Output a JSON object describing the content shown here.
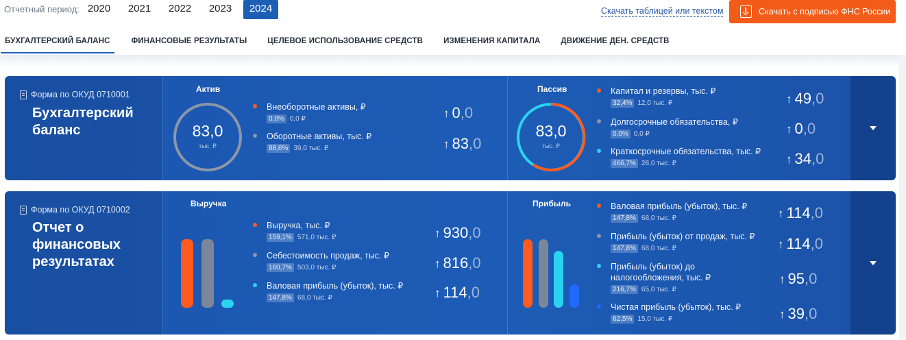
{
  "period": {
    "label": "Отчетный период:",
    "years": [
      "2020",
      "2021",
      "2022",
      "2023",
      "2024"
    ],
    "active_year": "2024"
  },
  "download": {
    "link_label": "Скачать таблицей или текстом",
    "button_label": "Скачать с подписью ФНС России"
  },
  "tabs": [
    "БУХГАЛТЕРСКИЙ БАЛАНС",
    "ФИНАНСОВЫЕ РЕЗУЛЬТАТЫ",
    "ЦЕЛЕВОЕ ИСПОЛЬЗОВАНИЕ СРЕДСТВ",
    "ИЗМЕНЕНИЯ КАПИТАЛА",
    "ДВИЖЕНИЕ ДЕН. СРЕДСТВ"
  ],
  "colors": {
    "accent": "#f25c18",
    "brand": "#1d5fb4",
    "orange": "#ff5b1f",
    "gray": "#7b8798",
    "cyan": "#2ad4f0",
    "blue": "#1f6bff"
  },
  "balance": {
    "form_code": "Форма по ОКУД 0710001",
    "title": "Бухгалтерский баланс",
    "assets": {
      "title": "Актив",
      "ring_value": "83,0",
      "ring_unit": "тыс. ₽",
      "items": [
        {
          "name": "Внеоборотные активы, ₽",
          "pct": "0,0%",
          "prev": "0,0 ₽",
          "value_int": "0",
          "value_dec": ",0",
          "color": "#ff5b1f"
        },
        {
          "name": "Оборотные активы, тыс. ₽",
          "pct": "88,6%",
          "prev": "39,0 тыс. ₽",
          "value_int": "83",
          "value_dec": ",0",
          "color": "#8b97a8"
        }
      ]
    },
    "liabilities": {
      "title": "Пассив",
      "ring_value": "83,0",
      "ring_unit": "тыс. ₽",
      "items": [
        {
          "name": "Капитал и резервы, тыс. ₽",
          "pct": "32,4%",
          "prev": "12,0 тыс. ₽",
          "value_int": "49",
          "value_dec": ",0",
          "color": "#ff5b1f"
        },
        {
          "name": "Долгосрочные обязательства, ₽",
          "pct": "0,0%",
          "prev": "0,0 ₽",
          "value_int": "0",
          "value_dec": ",0",
          "color": "#8b97a8"
        },
        {
          "name": "Краткосрочные обязательства, тыс. ₽",
          "pct": "466,7%",
          "prev": "28,0 тыс. ₽",
          "value_int": "34",
          "value_dec": ",0",
          "color": "#2ad4f0"
        }
      ]
    }
  },
  "results": {
    "form_code": "Форма по ОКУД 0710002",
    "title": "Отчет о финансовых результатах",
    "revenue": {
      "title": "Выручка",
      "items": [
        {
          "name": "Выручка, тыс. ₽",
          "pct": "159,1%",
          "prev": "571,0 тыс. ₽",
          "value_int": "930",
          "value_dec": ",0",
          "color": "#ff5b1f"
        },
        {
          "name": "Себестоимость продаж, тыс. ₽",
          "pct": "160,7%",
          "prev": "503,0 тыс. ₽",
          "value_int": "816",
          "value_dec": ",0",
          "color": "#8b97a8"
        },
        {
          "name": "Валовая прибыль (убыток), тыс. ₽",
          "pct": "147,8%",
          "prev": "68,0 тыс. ₽",
          "value_int": "114",
          "value_dec": ",0",
          "color": "#2ad4f0"
        }
      ]
    },
    "profit": {
      "title": "Прибыль",
      "items": [
        {
          "name": "Валовая прибыль (убыток), тыс. ₽",
          "pct": "147,8%",
          "prev": "68,0 тыс. ₽",
          "value_int": "114",
          "value_dec": ",0",
          "color": "#ff5b1f"
        },
        {
          "name": "Прибыль (убыток) от продаж, тыс. ₽",
          "pct": "147,8%",
          "prev": "68,0 тыс. ₽",
          "value_int": "114",
          "value_dec": ",0",
          "color": "#8b97a8"
        },
        {
          "name": "Прибыль (убыток) до налогообложения, тыс. ₽",
          "pct": "216,7%",
          "prev": "65,0 тыс. ₽",
          "value_int": "95",
          "value_dec": ",0",
          "color": "#2ad4f0"
        },
        {
          "name": "Чистая прибыль (убыток), тыс. ₽",
          "pct": "62,5%",
          "prev": "15,0 тыс. ₽",
          "value_int": "39",
          "value_dec": ",0",
          "color": "#1f6bff"
        }
      ]
    }
  }
}
